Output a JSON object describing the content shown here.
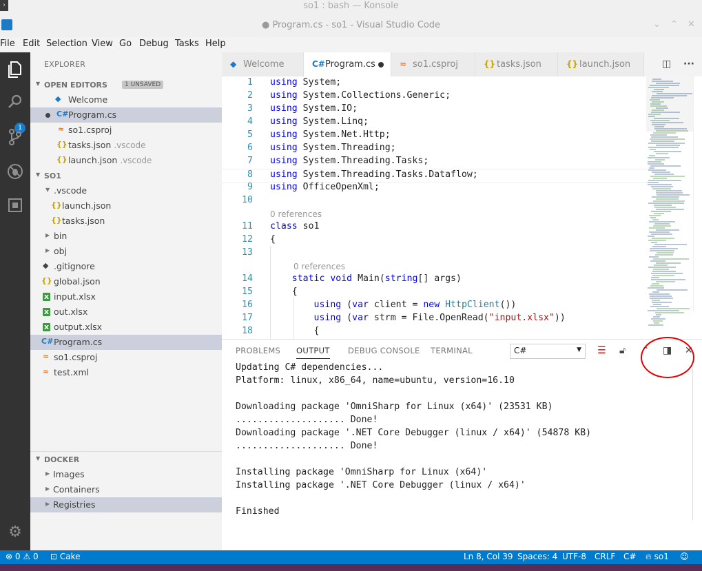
{
  "konsole": {
    "title": "so1 : bash — Konsole"
  },
  "window": {
    "title": "● Program.cs - so1 - Visual Studio Code"
  },
  "menu": [
    "File",
    "Edit",
    "Selection",
    "View",
    "Go",
    "Debug",
    "Tasks",
    "Help"
  ],
  "activity": {
    "badge": "1"
  },
  "explorer": {
    "title": "EXPLORER",
    "open_editors": {
      "label": "OPEN EDITORS",
      "pill": "1 UNSAVED",
      "items": [
        {
          "name": "Welcome",
          "desc": "",
          "icon": "vscode-icon"
        },
        {
          "name": "Program.cs",
          "desc": "",
          "icon": "csharp-icon"
        },
        {
          "name": "so1.csproj",
          "desc": "",
          "icon": "rss-icon"
        },
        {
          "name": "tasks.json",
          "desc": ".vscode",
          "icon": "json-icon"
        },
        {
          "name": "launch.json",
          "desc": ".vscode",
          "icon": "json-icon"
        }
      ]
    },
    "project": {
      "label": "SO1",
      "items": [
        {
          "name": ".vscode"
        },
        {
          "name": "launch.json"
        },
        {
          "name": "tasks.json"
        },
        {
          "name": "bin"
        },
        {
          "name": "obj"
        },
        {
          "name": ".gitignore"
        },
        {
          "name": "global.json"
        },
        {
          "name": "input.xlsx"
        },
        {
          "name": "out.xlsx"
        },
        {
          "name": "output.xlsx"
        },
        {
          "name": "Program.cs"
        },
        {
          "name": "so1.csproj"
        },
        {
          "name": "test.xml"
        }
      ]
    },
    "docker": {
      "label": "DOCKER",
      "items": [
        "Images",
        "Containers",
        "Registries"
      ]
    }
  },
  "tabs": [
    {
      "label": "Welcome"
    },
    {
      "label": "Program.cs"
    },
    {
      "label": "so1.csproj"
    },
    {
      "label": "tasks.json"
    },
    {
      "label": "launch.json"
    }
  ],
  "editor": {
    "lines": [
      {
        "n": "1",
        "code": "using System;"
      },
      {
        "n": "2",
        "code": "using System.Collections.Generic;"
      },
      {
        "n": "3",
        "code": "using System.IO;"
      },
      {
        "n": "4",
        "code": "using System.Linq;"
      },
      {
        "n": "5",
        "code": "using System.Net.Http;"
      },
      {
        "n": "6",
        "code": "using System.Threading;"
      },
      {
        "n": "7",
        "code": "using System.Threading.Tasks;"
      },
      {
        "n": "8",
        "code": "using System.Threading.Tasks.Dataflow;"
      },
      {
        "n": "9",
        "code": "using OfficeOpenXml;"
      },
      {
        "n": "10",
        "code": ""
      },
      {
        "n": "11",
        "code": "class so1"
      },
      {
        "n": "12",
        "code": "{"
      },
      {
        "n": "13",
        "code": ""
      },
      {
        "n": "14",
        "code": "    static void Main(string[] args)"
      },
      {
        "n": "15",
        "code": "    {"
      },
      {
        "n": "16",
        "code": "        using (var client = new HttpClient())"
      },
      {
        "n": "17",
        "code": "        using (var strm = File.OpenRead(\"input.xlsx\"))"
      },
      {
        "n": "18",
        "code": "        {"
      }
    ],
    "codelens_1": "0 references",
    "codelens_2": "0 references"
  },
  "panel": {
    "tabs": [
      "PROBLEMS",
      "OUTPUT",
      "DEBUG CONSOLE",
      "TERMINAL"
    ],
    "active_tab": "OUTPUT",
    "channel": "C#",
    "output": [
      "Updating C# dependencies...",
      "Platform: linux, x86_64, name=ubuntu, version=16.10",
      "",
      "Downloading package 'OmniSharp for Linux (x64)' (23531 KB)",
      ".................... Done!",
      "Downloading package '.NET Core Debugger (linux / x64)' (54878 KB)",
      ".................... Done!",
      "",
      "Installing package 'OmniSharp for Linux (x64)'",
      "Installing package '.NET Core Debugger (linux / x64)'",
      "",
      "Finished"
    ]
  },
  "statusbar": {
    "errors": "0",
    "warnings": "0",
    "cake": "Cake",
    "position": "Ln 8, Col 39",
    "spaces": "Spaces: 4",
    "encoding": "UTF-8",
    "eol": "CRLF",
    "language": "C#",
    "project": "so1"
  },
  "colors": {
    "accent": "#007acc",
    "annotation": "#e00000",
    "activity_bar": "#333333"
  }
}
